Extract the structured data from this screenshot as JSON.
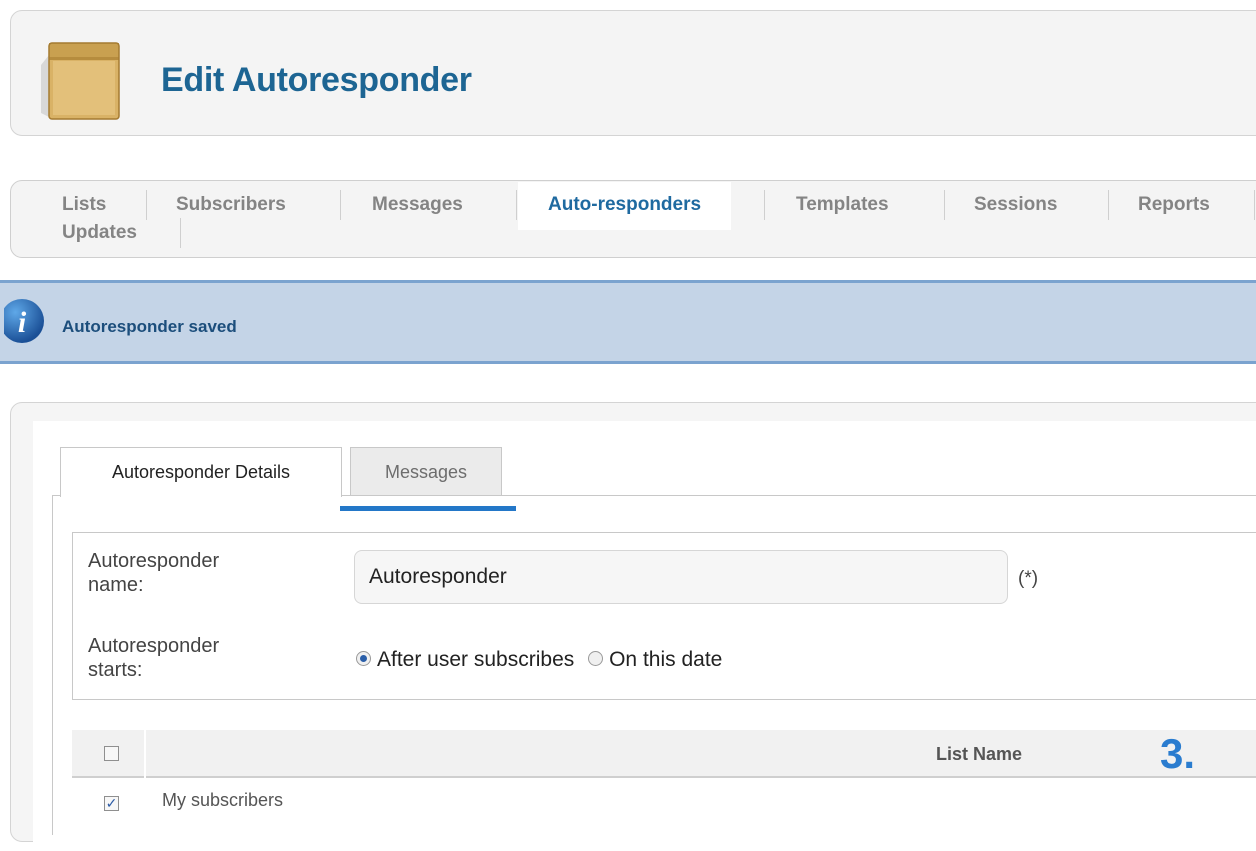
{
  "header": {
    "title": "Edit Autoresponder",
    "icon": "package-box-icon"
  },
  "nav": {
    "items": [
      "Lists",
      "Subscribers",
      "Messages",
      "Auto-responders",
      "Templates",
      "Sessions",
      "Reports",
      "Updates"
    ],
    "active": "Auto-responders"
  },
  "alert": {
    "text": "Autoresponder saved",
    "icon": "info-icon"
  },
  "tabs": {
    "details": "Autoresponder Details",
    "messages": "Messages"
  },
  "form": {
    "name_label_line1": "Autoresponder",
    "name_label_line2": "name:",
    "name_value": "Autoresponder",
    "required_marker": "(*)",
    "starts_label_line1": "Autoresponder",
    "starts_label_line2": "starts:",
    "starts_options": [
      "After user subscribes",
      "On this date"
    ],
    "starts_selected": "After user subscribes"
  },
  "list_table": {
    "header": "List Name",
    "rows": [
      {
        "name": "My subscribers",
        "checked": true
      }
    ],
    "step_marker": "3."
  },
  "colors": {
    "title": "#1d6593",
    "nav_active": "#1f6aa0",
    "alert_bg": "#c4d4e7",
    "accent": "#2377c8"
  }
}
